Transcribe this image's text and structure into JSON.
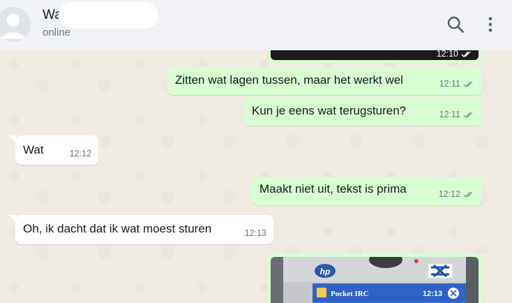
{
  "header": {
    "contact_name": "Wa",
    "status": "online"
  },
  "messages": [
    {
      "type": "out-image",
      "time": "12:10"
    },
    {
      "type": "out",
      "text": "Zitten wat lagen tussen, maar het werkt wel",
      "time": "12:11"
    },
    {
      "type": "out",
      "text": "Kun je eens wat terugsturen?",
      "time": "12:11"
    },
    {
      "type": "in",
      "text": "Wat",
      "time": "12:12"
    },
    {
      "type": "out",
      "text": "Maakt niet uit, tekst is prima",
      "time": "12:12"
    },
    {
      "type": "in",
      "text": "Oh, ik dacht dat ik wat moest sturen",
      "time": "12:13"
    },
    {
      "type": "out-image",
      "device_text": {
        "brand": "hp",
        "app": "Pocket IRC",
        "clock": "12:13"
      }
    }
  ],
  "colors": {
    "outgoing_bubble": "#d9fdd3",
    "incoming_bubble": "#ffffff",
    "chat_background": "#efeae2",
    "header_background": "#f0f2f5"
  },
  "icons": [
    "avatar-placeholder",
    "search-icon",
    "menu-icon",
    "double-check-icon"
  ]
}
